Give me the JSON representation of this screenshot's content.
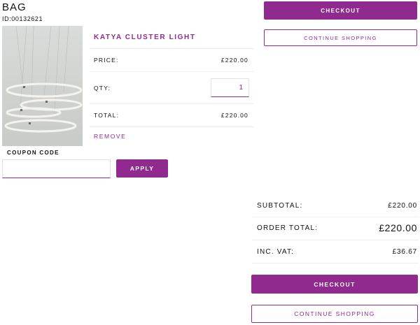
{
  "header": {
    "title": "BAG",
    "id_text": "ID:00132621"
  },
  "product": {
    "name": "KATYA CLUSTER LIGHT",
    "price_label": "PRICE:",
    "price_value": "£220.00",
    "qty_label": "QTY:",
    "qty_value": "1",
    "total_label": "TOTAL:",
    "total_value": "£220.00",
    "remove_label": "REMOVE",
    "image_icon": "pendant-ring-light-photo"
  },
  "coupon": {
    "label": "COUPON CODE",
    "input_value": "",
    "apply_label": "APPLY"
  },
  "actions_top": {
    "checkout_label": "CHECKOUT",
    "continue_label": "CONTINUE SHOPPING"
  },
  "summary": {
    "subtotal_label": "SUBTOTAL:",
    "subtotal_value": "£220.00",
    "order_total_label": "ORDER TOTAL:",
    "order_total_value": "£220.00",
    "vat_label": "INC. VAT:",
    "vat_value": "£36.67"
  },
  "actions_bottom": {
    "checkout_label": "CHECKOUT",
    "continue_label": "CONTINUE SHOPPING"
  },
  "colors": {
    "accent": "#912a8f",
    "divider": "#ededed",
    "text": "#111111"
  }
}
